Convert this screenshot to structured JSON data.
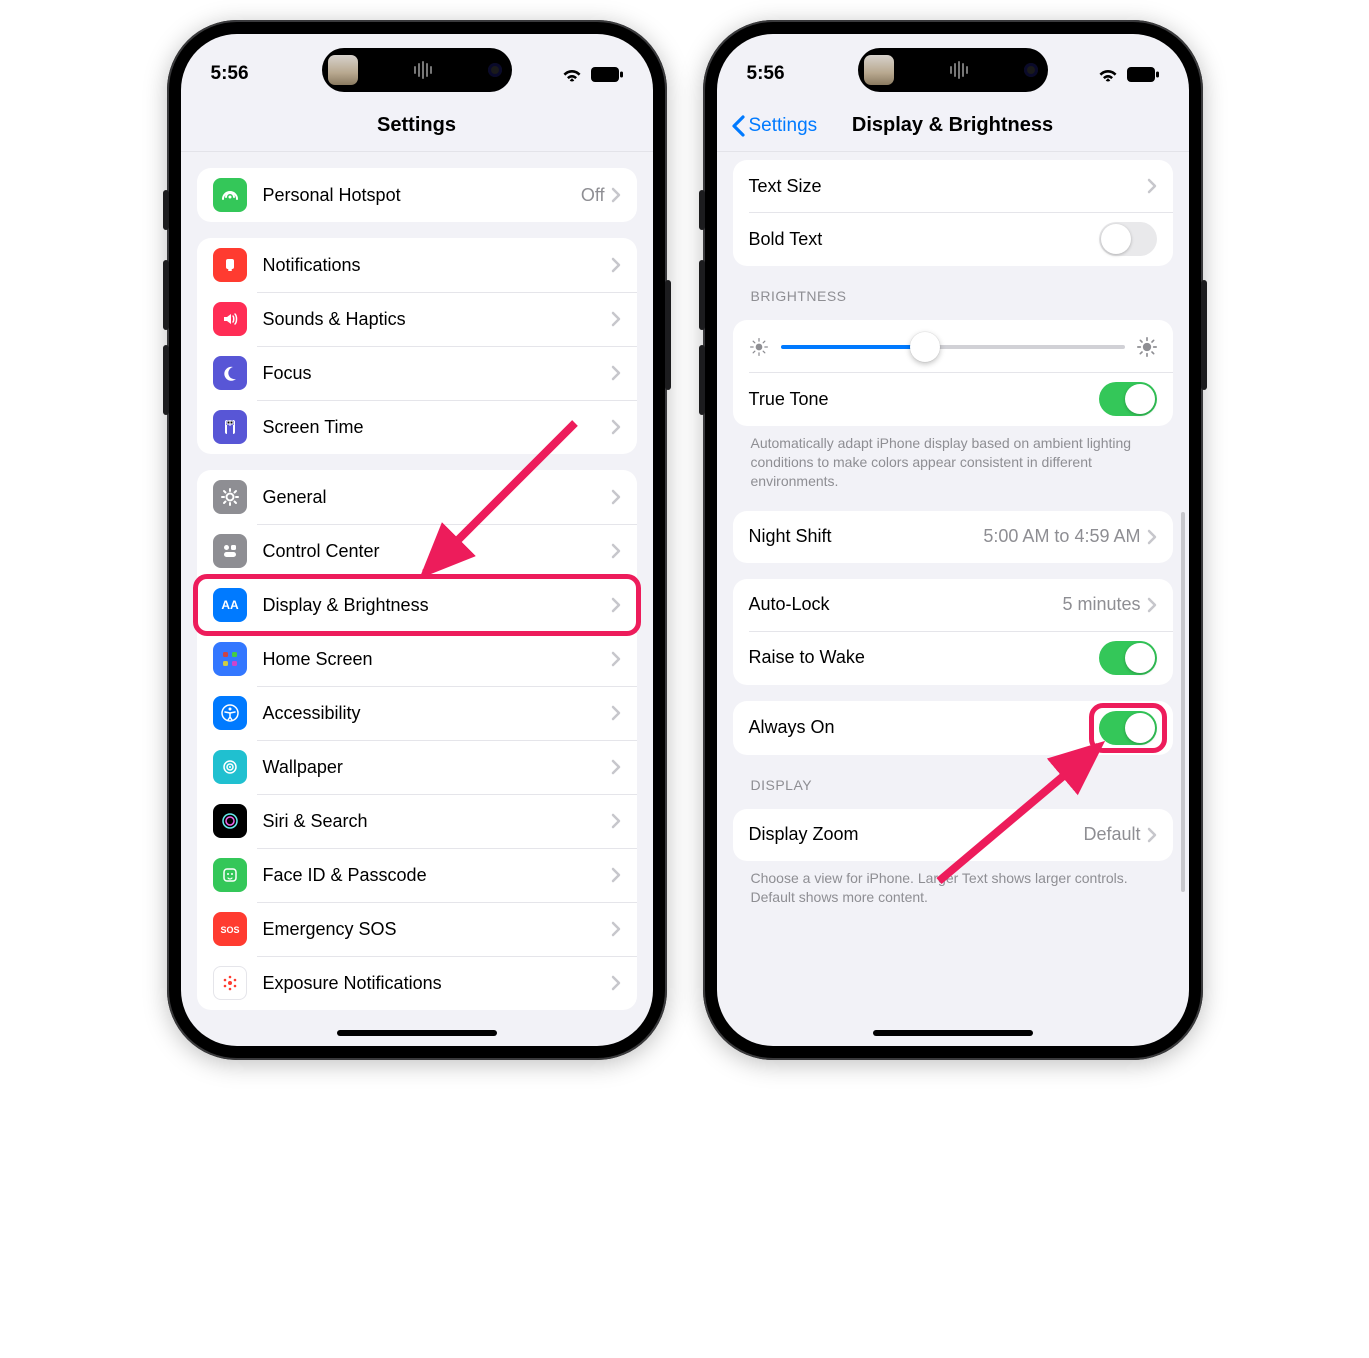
{
  "status_time": "5:56",
  "phone1": {
    "title": "Settings",
    "groups": [
      {
        "cells": [
          {
            "icon": "hotspot",
            "label": "Personal Hotspot",
            "value": "Off"
          }
        ]
      },
      {
        "cells": [
          {
            "icon": "notifications",
            "label": "Notifications"
          },
          {
            "icon": "sounds",
            "label": "Sounds & Haptics"
          },
          {
            "icon": "focus",
            "label": "Focus"
          },
          {
            "icon": "screentime",
            "label": "Screen Time"
          }
        ]
      },
      {
        "cells": [
          {
            "icon": "general",
            "label": "General"
          },
          {
            "icon": "controlcenter",
            "label": "Control Center"
          },
          {
            "icon": "display",
            "label": "Display & Brightness",
            "highlighted": true
          },
          {
            "icon": "homescreen",
            "label": "Home Screen"
          },
          {
            "icon": "accessibility",
            "label": "Accessibility"
          },
          {
            "icon": "wallpaper",
            "label": "Wallpaper"
          },
          {
            "icon": "siri",
            "label": "Siri & Search"
          },
          {
            "icon": "faceid",
            "label": "Face ID & Passcode"
          },
          {
            "icon": "sos",
            "label": "Emergency SOS"
          },
          {
            "icon": "exposure",
            "label": "Exposure Notifications"
          }
        ]
      }
    ]
  },
  "phone2": {
    "back": "Settings",
    "title": "Display & Brightness",
    "text_size_label": "Text Size",
    "bold_text_label": "Bold Text",
    "bold_text_on": false,
    "brightness_header": "BRIGHTNESS",
    "brightness_value": 42,
    "true_tone_label": "True Tone",
    "true_tone_on": true,
    "true_tone_footer": "Automatically adapt iPhone display based on ambient lighting conditions to make colors appear consistent in different environments.",
    "night_shift_label": "Night Shift",
    "night_shift_value": "5:00 AM to 4:59 AM",
    "auto_lock_label": "Auto-Lock",
    "auto_lock_value": "5 minutes",
    "raise_label": "Raise to Wake",
    "raise_on": true,
    "always_on_label": "Always On",
    "always_on_on": true,
    "display_header": "DISPLAY",
    "display_zoom_label": "Display Zoom",
    "display_zoom_value": "Default",
    "display_zoom_footer": "Choose a view for iPhone. Larger Text shows larger controls. Default shows more content."
  }
}
